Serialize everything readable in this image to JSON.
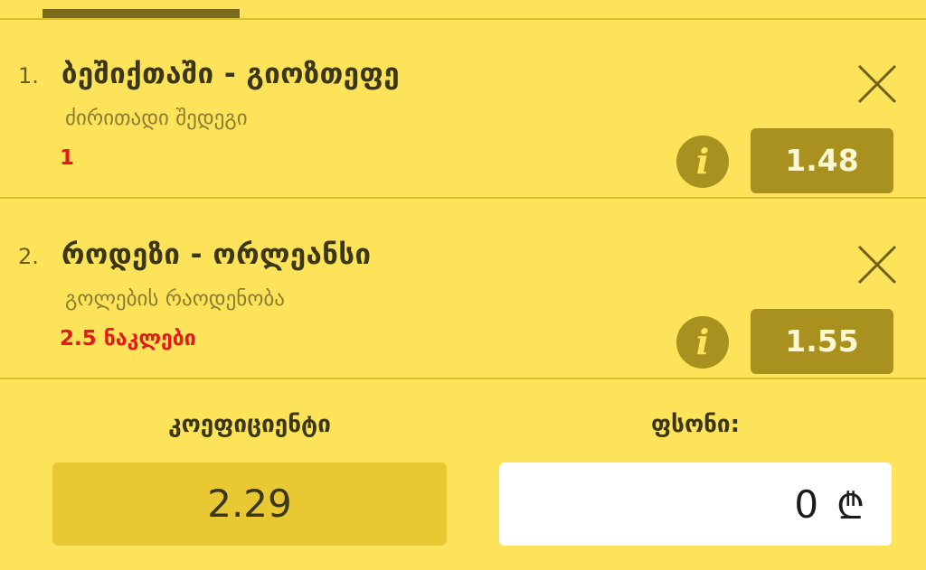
{
  "betslip": {
    "bets": [
      {
        "number": "1.",
        "match": "ბეშიქთაში - გიოზთეფე",
        "market": "ძირითადი შედეგი",
        "pick": "1",
        "odds": "1.48",
        "info_icon": "i"
      },
      {
        "number": "2.",
        "match": "როდეზი - ორლეანსი",
        "market": "გოლების რაოდენობა",
        "pick": "2.5 ნაკლები",
        "odds": "1.55",
        "info_icon": "i"
      }
    ],
    "summary": {
      "coefficient_label": "კოეფიციენტი",
      "coefficient_value": "2.29",
      "stake_label": "ფსონი:",
      "stake_value": "0",
      "currency_symbol": "₾"
    }
  },
  "colors": {
    "background": "#fce35a",
    "accent_dark": "#a99120",
    "pick_red": "#e01b1b"
  }
}
